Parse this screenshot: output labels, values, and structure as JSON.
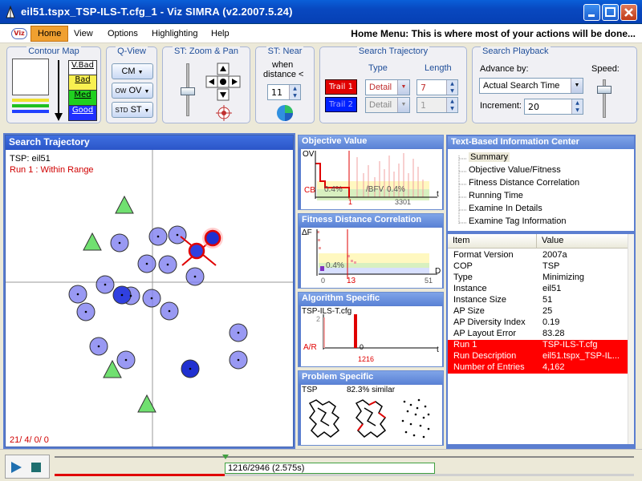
{
  "window": {
    "title": "eil51.tspx_TSP-ILS-T.cfg_1 - Viz SIMRA (v2.2007.5.24)"
  },
  "menu": {
    "logo": "Viz",
    "items": [
      "Home",
      "View",
      "Options",
      "Highlighting",
      "Help"
    ],
    "active": "Home",
    "hint": "Home Menu: This is where most of your actions will be done..."
  },
  "toolbar": {
    "contour_map": {
      "title": "Contour Map",
      "legend": [
        "V.Bad",
        "Bad",
        "Med",
        "Good"
      ]
    },
    "q_view": {
      "title": "Q-View",
      "buttons": [
        "CM",
        "OV",
        "ST"
      ],
      "sublabels": [
        "",
        "OV",
        "ST"
      ],
      "prefixes": [
        "",
        "OW",
        "STD"
      ]
    },
    "zoom_pan": {
      "title": "ST: Zoom & Pan"
    },
    "st_near": {
      "title": "ST: Near",
      "label1": "when",
      "label2": "distance <",
      "value": "11"
    },
    "search_traj": {
      "title": "Search Trajectory",
      "type_label": "Type",
      "length_label": "Length",
      "trail1": "Trail 1",
      "trail2": "Trail 2",
      "type1": "Detail",
      "type2": "Detail",
      "len1": "7",
      "len2": "1"
    },
    "playback": {
      "title": "Search Playback",
      "advance_label": "Advance by:",
      "advance_value": "Actual Search Time",
      "increment_label": "Increment:",
      "increment_value": "20",
      "speed_label": "Speed:"
    }
  },
  "search_traj_panel": {
    "title": "Search Trajectory",
    "tsp": "TSP: eil51",
    "run": "Run 1 : Within Range",
    "footer": "21/ 4/ 0/ 0"
  },
  "objective_panel": {
    "title": "Objective Value",
    "ov": "OV",
    "cb": "CB",
    "pct1": "0.4%",
    "pct2": "0.4%",
    "avg": "/BFV",
    "x_start": "1",
    "x_end": "3301",
    "t": "t"
  },
  "fdc_panel": {
    "title": "Fitness Distance Correlation",
    "df": "ΔF",
    "pct": "0.4%",
    "x0": "0",
    "x1": "13",
    "x2": "51",
    "d": "D"
  },
  "algo_panel": {
    "title": "Algorithm Specific",
    "cfg": "TSP-ILS-T.cfg",
    "ar": "A/R",
    "y2": "2",
    "x0": "0",
    "x1": "1216",
    "t": "t"
  },
  "problem_panel": {
    "title": "Problem Specific",
    "tsp": "TSP",
    "similar": "82.3% similar"
  },
  "info_center": {
    "title": "Text-Based Information Center",
    "tree": [
      "Summary",
      "Objective Value/Fitness",
      "Fitness Distance Correlation",
      "Running Time",
      "Examine In Details",
      "Examine Tag Information"
    ]
  },
  "table": {
    "headers": [
      "Item",
      "Value"
    ],
    "rows": [
      {
        "item": "Format Version",
        "value": "2007a",
        "hl": false
      },
      {
        "item": "COP",
        "value": "TSP",
        "hl": false
      },
      {
        "item": "Type",
        "value": "Minimizing",
        "hl": false
      },
      {
        "item": "Instance",
        "value": "eil51",
        "hl": false
      },
      {
        "item": "Instance Size",
        "value": "51",
        "hl": false
      },
      {
        "item": "AP Size",
        "value": "25",
        "hl": false
      },
      {
        "item": "AP Diversity Index",
        "value": "0.19",
        "hl": false
      },
      {
        "item": "AP Layout Error",
        "value": "83.28",
        "hl": false
      },
      {
        "item": "Run 1",
        "value": "TSP-ILS-T.cfg",
        "hl": true
      },
      {
        "item": "Run Description",
        "value": "eil51.tspx_TSP-IL...",
        "hl": true
      },
      {
        "item": "Number of Entries",
        "value": "4,162",
        "hl": true
      }
    ]
  },
  "playback": {
    "status": "1216/2946 (2.575s)"
  }
}
